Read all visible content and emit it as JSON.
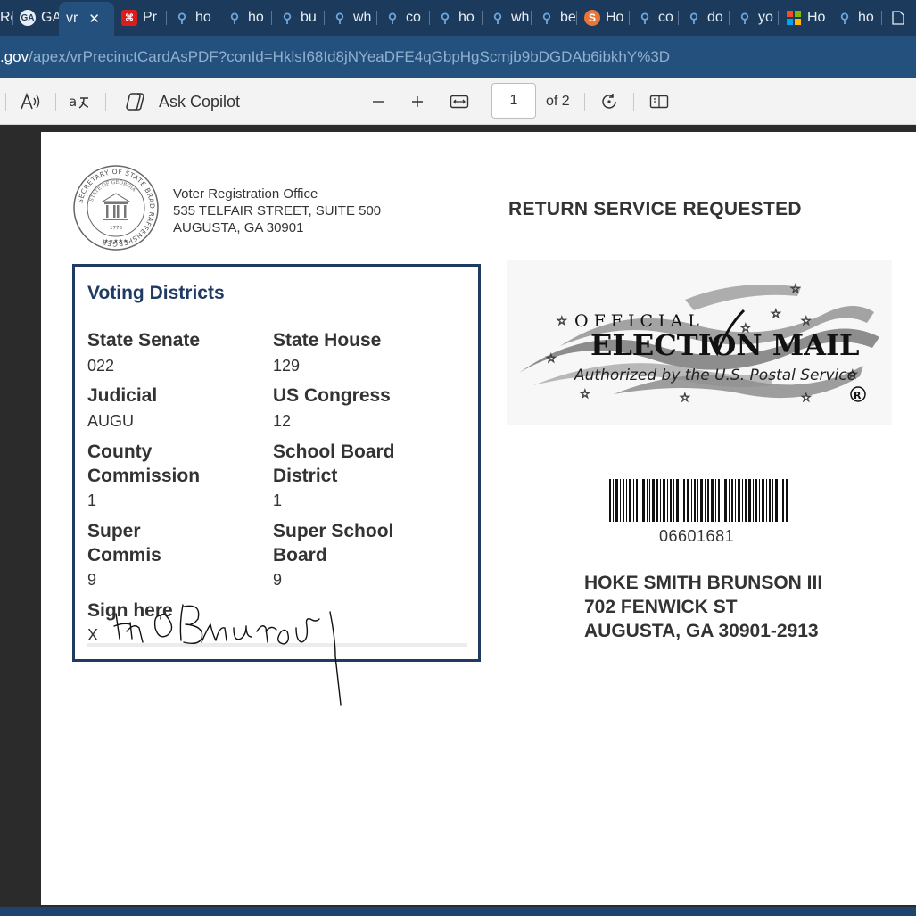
{
  "browser": {
    "tabs": [
      {
        "label": "Re",
        "icon": "page-icon"
      },
      {
        "label": "GA",
        "icon": "ga-icon"
      },
      {
        "label": "vr",
        "icon": "",
        "active": true
      },
      {
        "label": "Pr",
        "icon": "pdf-icon"
      },
      {
        "label": "ho",
        "icon": "search-icon"
      },
      {
        "label": "ho",
        "icon": "search-icon"
      },
      {
        "label": "bu",
        "icon": "search-icon"
      },
      {
        "label": "wh",
        "icon": "search-icon"
      },
      {
        "label": "co",
        "icon": "search-icon"
      },
      {
        "label": "ho",
        "icon": "search-icon"
      },
      {
        "label": "wh",
        "icon": "search-icon"
      },
      {
        "label": "be",
        "icon": "search-icon"
      },
      {
        "label": "Ho",
        "icon": "s-icon"
      },
      {
        "label": "co",
        "icon": "search-icon"
      },
      {
        "label": "do",
        "icon": "search-icon"
      },
      {
        "label": "yo",
        "icon": "search-icon"
      },
      {
        "label": "Ho",
        "icon": "microsoft-icon"
      },
      {
        "label": "ho",
        "icon": "search-icon"
      }
    ],
    "url_host": ".gov",
    "url_path": "/apex/vrPrecinctCardAsPDF?conId=HklsI68Id8jNYeaDFE4qGbpHgScmjb9bDGDAb6ibkhY%3D"
  },
  "pdf_toolbar": {
    "copilot_label": "Ask Copilot",
    "page_current": "1",
    "page_total": "of 2"
  },
  "card": {
    "office_name": "Voter Registration Office",
    "office_street": "535 TELFAIR STREET, SUITE 500",
    "office_city": "AUGUSTA, GA 30901",
    "return_service": "RETURN SERVICE REQUESTED",
    "districts_title": "Voting Districts",
    "districts": [
      {
        "label": "State Senate",
        "value": "022"
      },
      {
        "label": "State House",
        "value": "129"
      },
      {
        "label": "Judicial",
        "value": "AUGU"
      },
      {
        "label": "US Congress",
        "value": "12"
      },
      {
        "label": "County Commission",
        "value": "1"
      },
      {
        "label": "School Board District",
        "value": "1"
      },
      {
        "label": "Super Commis",
        "value": "9"
      },
      {
        "label": "Super School Board",
        "value": "9"
      }
    ],
    "sign_label": "Sign here",
    "sign_x": "X",
    "signature": "HS Brunson",
    "emblem": {
      "line1": "OFFICIAL",
      "line2": "ELECTION MAIL",
      "line3": "Authorized by the U.S. Postal Service",
      "registered": "®"
    },
    "seal": {
      "ring_text": "SECRETARY OF STATE BRAD RAFFENSPERGER",
      "inner_text": "STATE OF GEORGIA",
      "year": "1776"
    },
    "barcode_number": "06601681",
    "recipient_name": "HOKE SMITH BRUNSON III",
    "recipient_street": "702 FENWICK ST",
    "recipient_city": "AUGUSTA, GA 30901-2913"
  },
  "colors": {
    "tabstrip": "#1b3a5c",
    "addressbar": "#24507d",
    "district_accent": "#1f3a63"
  }
}
